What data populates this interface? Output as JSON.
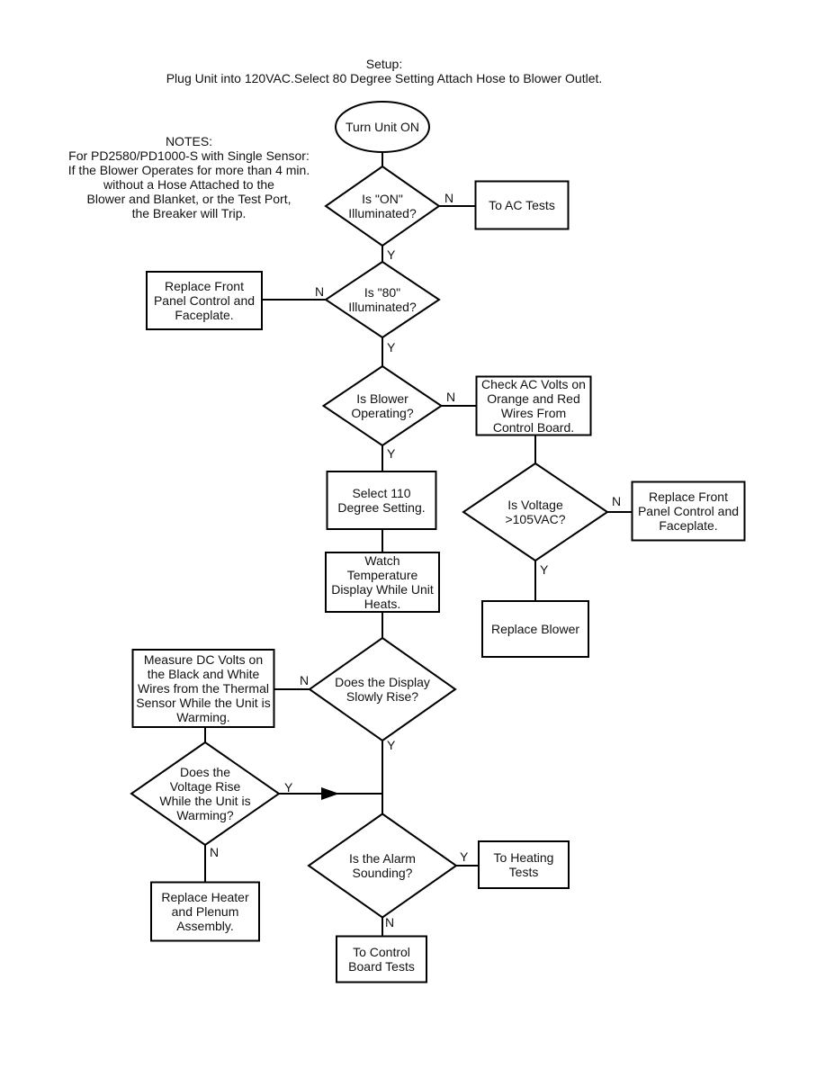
{
  "setup": {
    "heading": "Setup:",
    "text": "Plug Unit into 120VAC.Select 80 Degree Setting Attach Hose to Blower Outlet."
  },
  "notes": {
    "lines": [
      "NOTES:",
      "For PD2580/PD1000-S with Single Sensor:",
      "If the Blower Operates for more than 4 min.",
      "without a Hose Attached to the",
      "Blower and Blanket, or the Test Port,",
      "the Breaker will Trip."
    ]
  },
  "nodes": {
    "start": {
      "lines": [
        "Turn Unit ON"
      ]
    },
    "on_illuminated": {
      "lines": [
        "Is \"ON\"",
        "Illuminated?"
      ]
    },
    "ac_tests": {
      "lines": [
        "To AC Tests"
      ]
    },
    "eighty_illuminated": {
      "lines": [
        "Is \"80\"",
        "Illuminated?"
      ]
    },
    "replace_front_panel_1": {
      "lines": [
        "Replace Front",
        "Panel Control and",
        "Faceplate."
      ]
    },
    "blower_operating": {
      "lines": [
        "Is Blower",
        "Operating?"
      ]
    },
    "check_ac_volts": {
      "lines": [
        "Check AC Volts on",
        "Orange and Red",
        "Wires From",
        "Control Board."
      ]
    },
    "voltage_105": {
      "lines": [
        "Is Voltage",
        ">105VAC?"
      ]
    },
    "replace_front_panel_2": {
      "lines": [
        "Replace Front",
        "Panel Control and",
        "Faceplate."
      ]
    },
    "replace_blower": {
      "lines": [
        "Replace Blower"
      ]
    },
    "select_110": {
      "lines": [
        "Select 110",
        "Degree Setting."
      ]
    },
    "watch_temp": {
      "lines": [
        "Watch",
        "Temperature",
        "Display While Unit",
        "Heats."
      ]
    },
    "display_rise": {
      "lines": [
        "Does the Display",
        "Slowly Rise?"
      ]
    },
    "measure_dc": {
      "lines": [
        "Measure DC Volts on",
        "the Black and White",
        "Wires from the Thermal",
        "Sensor While the Unit is",
        "Warming."
      ]
    },
    "voltage_rise": {
      "lines": [
        "Does the",
        "Voltage Rise",
        "While the Unit is",
        "Warming?"
      ]
    },
    "replace_heater": {
      "lines": [
        "Replace Heater",
        "and Plenum",
        "Assembly."
      ]
    },
    "alarm_sounding": {
      "lines": [
        "Is the Alarm",
        "Sounding?"
      ]
    },
    "heating_tests": {
      "lines": [
        "To Heating",
        "Tests"
      ]
    },
    "control_board_tests": {
      "lines": [
        "To Control",
        "Board Tests"
      ]
    }
  },
  "edge_labels": {
    "yes": "Y",
    "no": "N"
  }
}
